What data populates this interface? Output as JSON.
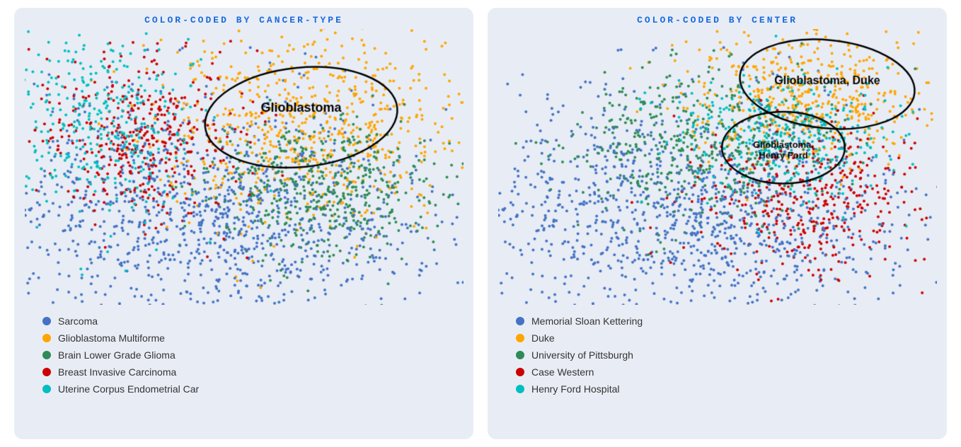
{
  "left_panel": {
    "title": "COLOR-CODED BY CANCER-TYPE",
    "annotation": "Glioblastoma",
    "legend": [
      {
        "label": "Sarcoma",
        "color": "#4472C4"
      },
      {
        "label": "Glioblastoma Multiforme",
        "color": "#FFA500"
      },
      {
        "label": "Brain Lower Grade Glioma",
        "color": "#2E8B57"
      },
      {
        "label": "Breast Invasive Carcinoma",
        "color": "#CC0000"
      },
      {
        "label": "Uterine Corpus Endometrial Car",
        "color": "#00BFBF"
      }
    ]
  },
  "right_panel": {
    "title": "COLOR-CODED BY CENTER",
    "annotation1": "Glioblastoma, Duke",
    "annotation2": "Glioblastoma, Henry Ford",
    "legend": [
      {
        "label": "Memorial Sloan Kettering",
        "color": "#4472C4"
      },
      {
        "label": "Duke",
        "color": "#FFA500"
      },
      {
        "label": "University of Pittsburgh",
        "color": "#2E8B57"
      },
      {
        "label": "Case Western",
        "color": "#CC0000"
      },
      {
        "label": "Henry Ford Hospital",
        "color": "#00BFBF"
      }
    ]
  }
}
